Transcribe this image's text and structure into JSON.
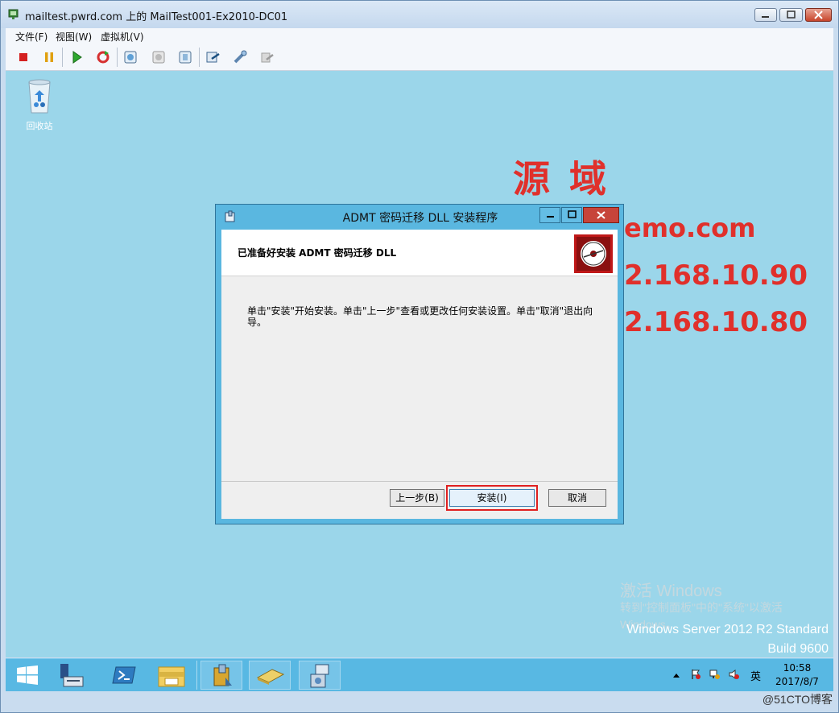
{
  "window": {
    "title": "mailtest.pwrd.com 上的 MailTest001-Ex2010-DC01"
  },
  "menu": {
    "items": [
      {
        "label": "文件(F)"
      },
      {
        "label": "视图(W)"
      },
      {
        "label": "虚拟机(V)"
      }
    ]
  },
  "toolbar": {
    "icons": [
      "stop-icon",
      "pause-icon",
      "start-icon",
      "reset-icon",
      "snapshot-icon",
      "revert-icon",
      "settings-icon",
      "connect-icon",
      "tools-icon",
      "disabled-tool-icon"
    ]
  },
  "desktop": {
    "recycle_bin_label": "回收站",
    "wallpaper": {
      "heading": "源 域",
      "line1": "emo.com",
      "line2": "2.168.10.90",
      "line3": "2.168.10.80"
    },
    "activation": {
      "title": "激活 Windows",
      "line1": "转到\"控制面板\"中的\"系统\"以激活",
      "line2": "Windows。"
    },
    "server_info": {
      "line1": "Windows Server 2012 R2 Standard",
      "line2": "Build 9600"
    }
  },
  "dialog": {
    "title": "ADMT 密码迁移 DLL 安装程序",
    "header": "已准备好安装 ADMT 密码迁移 DLL",
    "body_line1": "单击\"安装\"开始安装。单击\"上一步\"查看或更改任何安装设置。单击\"取消\"退出向",
    "body_line2": "导。",
    "back_label": "上一步(B)",
    "install_label": "安装(I)",
    "cancel_label": "取消",
    "highlight_color": "#e02020"
  },
  "taskbar": {
    "lang": "英",
    "time": "10:58",
    "date": "2017/8/7"
  },
  "watermark": "@51CTO博客"
}
